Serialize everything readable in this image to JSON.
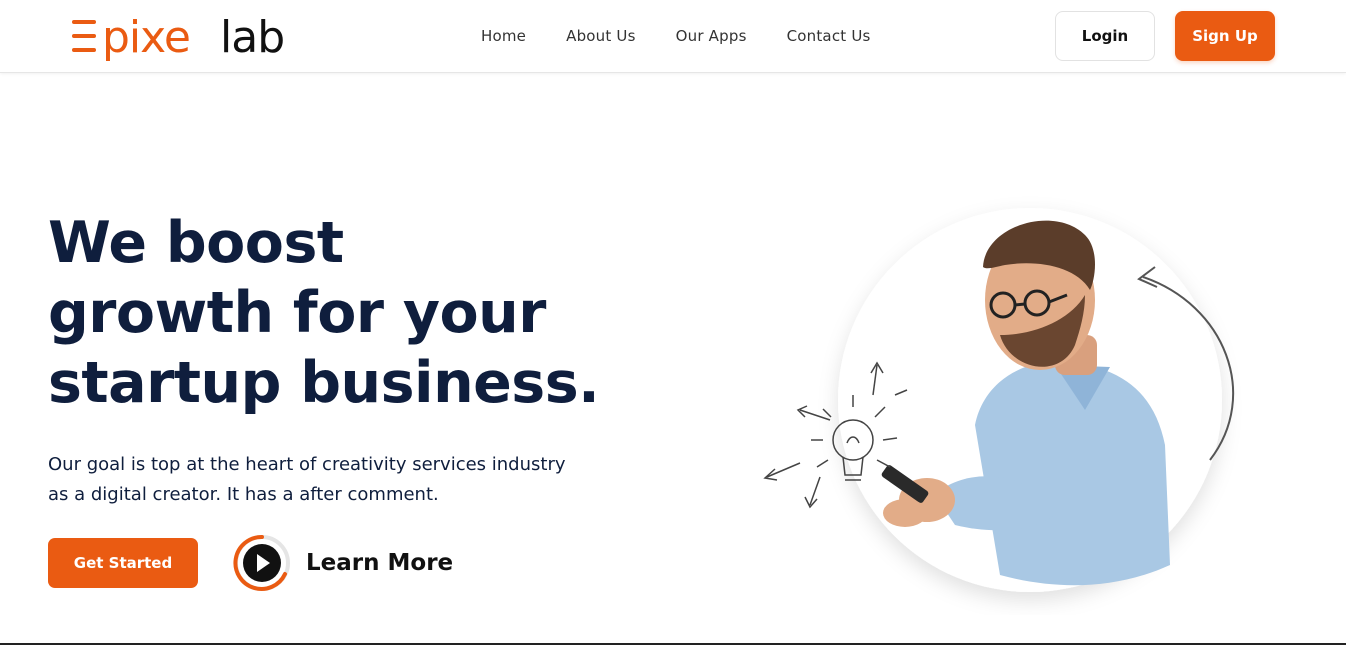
{
  "brand": {
    "logo_text_orange": "pixe",
    "logo_text_dark": "lab",
    "accent_color": "#ea5b12",
    "dark_color": "#0f1e3d"
  },
  "nav": {
    "links": [
      "Home",
      "About Us",
      "Our Apps",
      "Contact Us"
    ],
    "login_label": "Login",
    "signup_label": "Sign Up"
  },
  "hero": {
    "title_lines": [
      "We boost",
      "growth for your",
      "startup business."
    ],
    "subtitle_lines": [
      "Our goal is top at the heart of creativity services industry",
      "as a digital creator. It has a after comment."
    ],
    "cta_primary": "Get Started",
    "cta_secondary": "Learn More",
    "play_icon": "play-icon",
    "illustration": "man-with-phone-lightbulb-sketch"
  }
}
